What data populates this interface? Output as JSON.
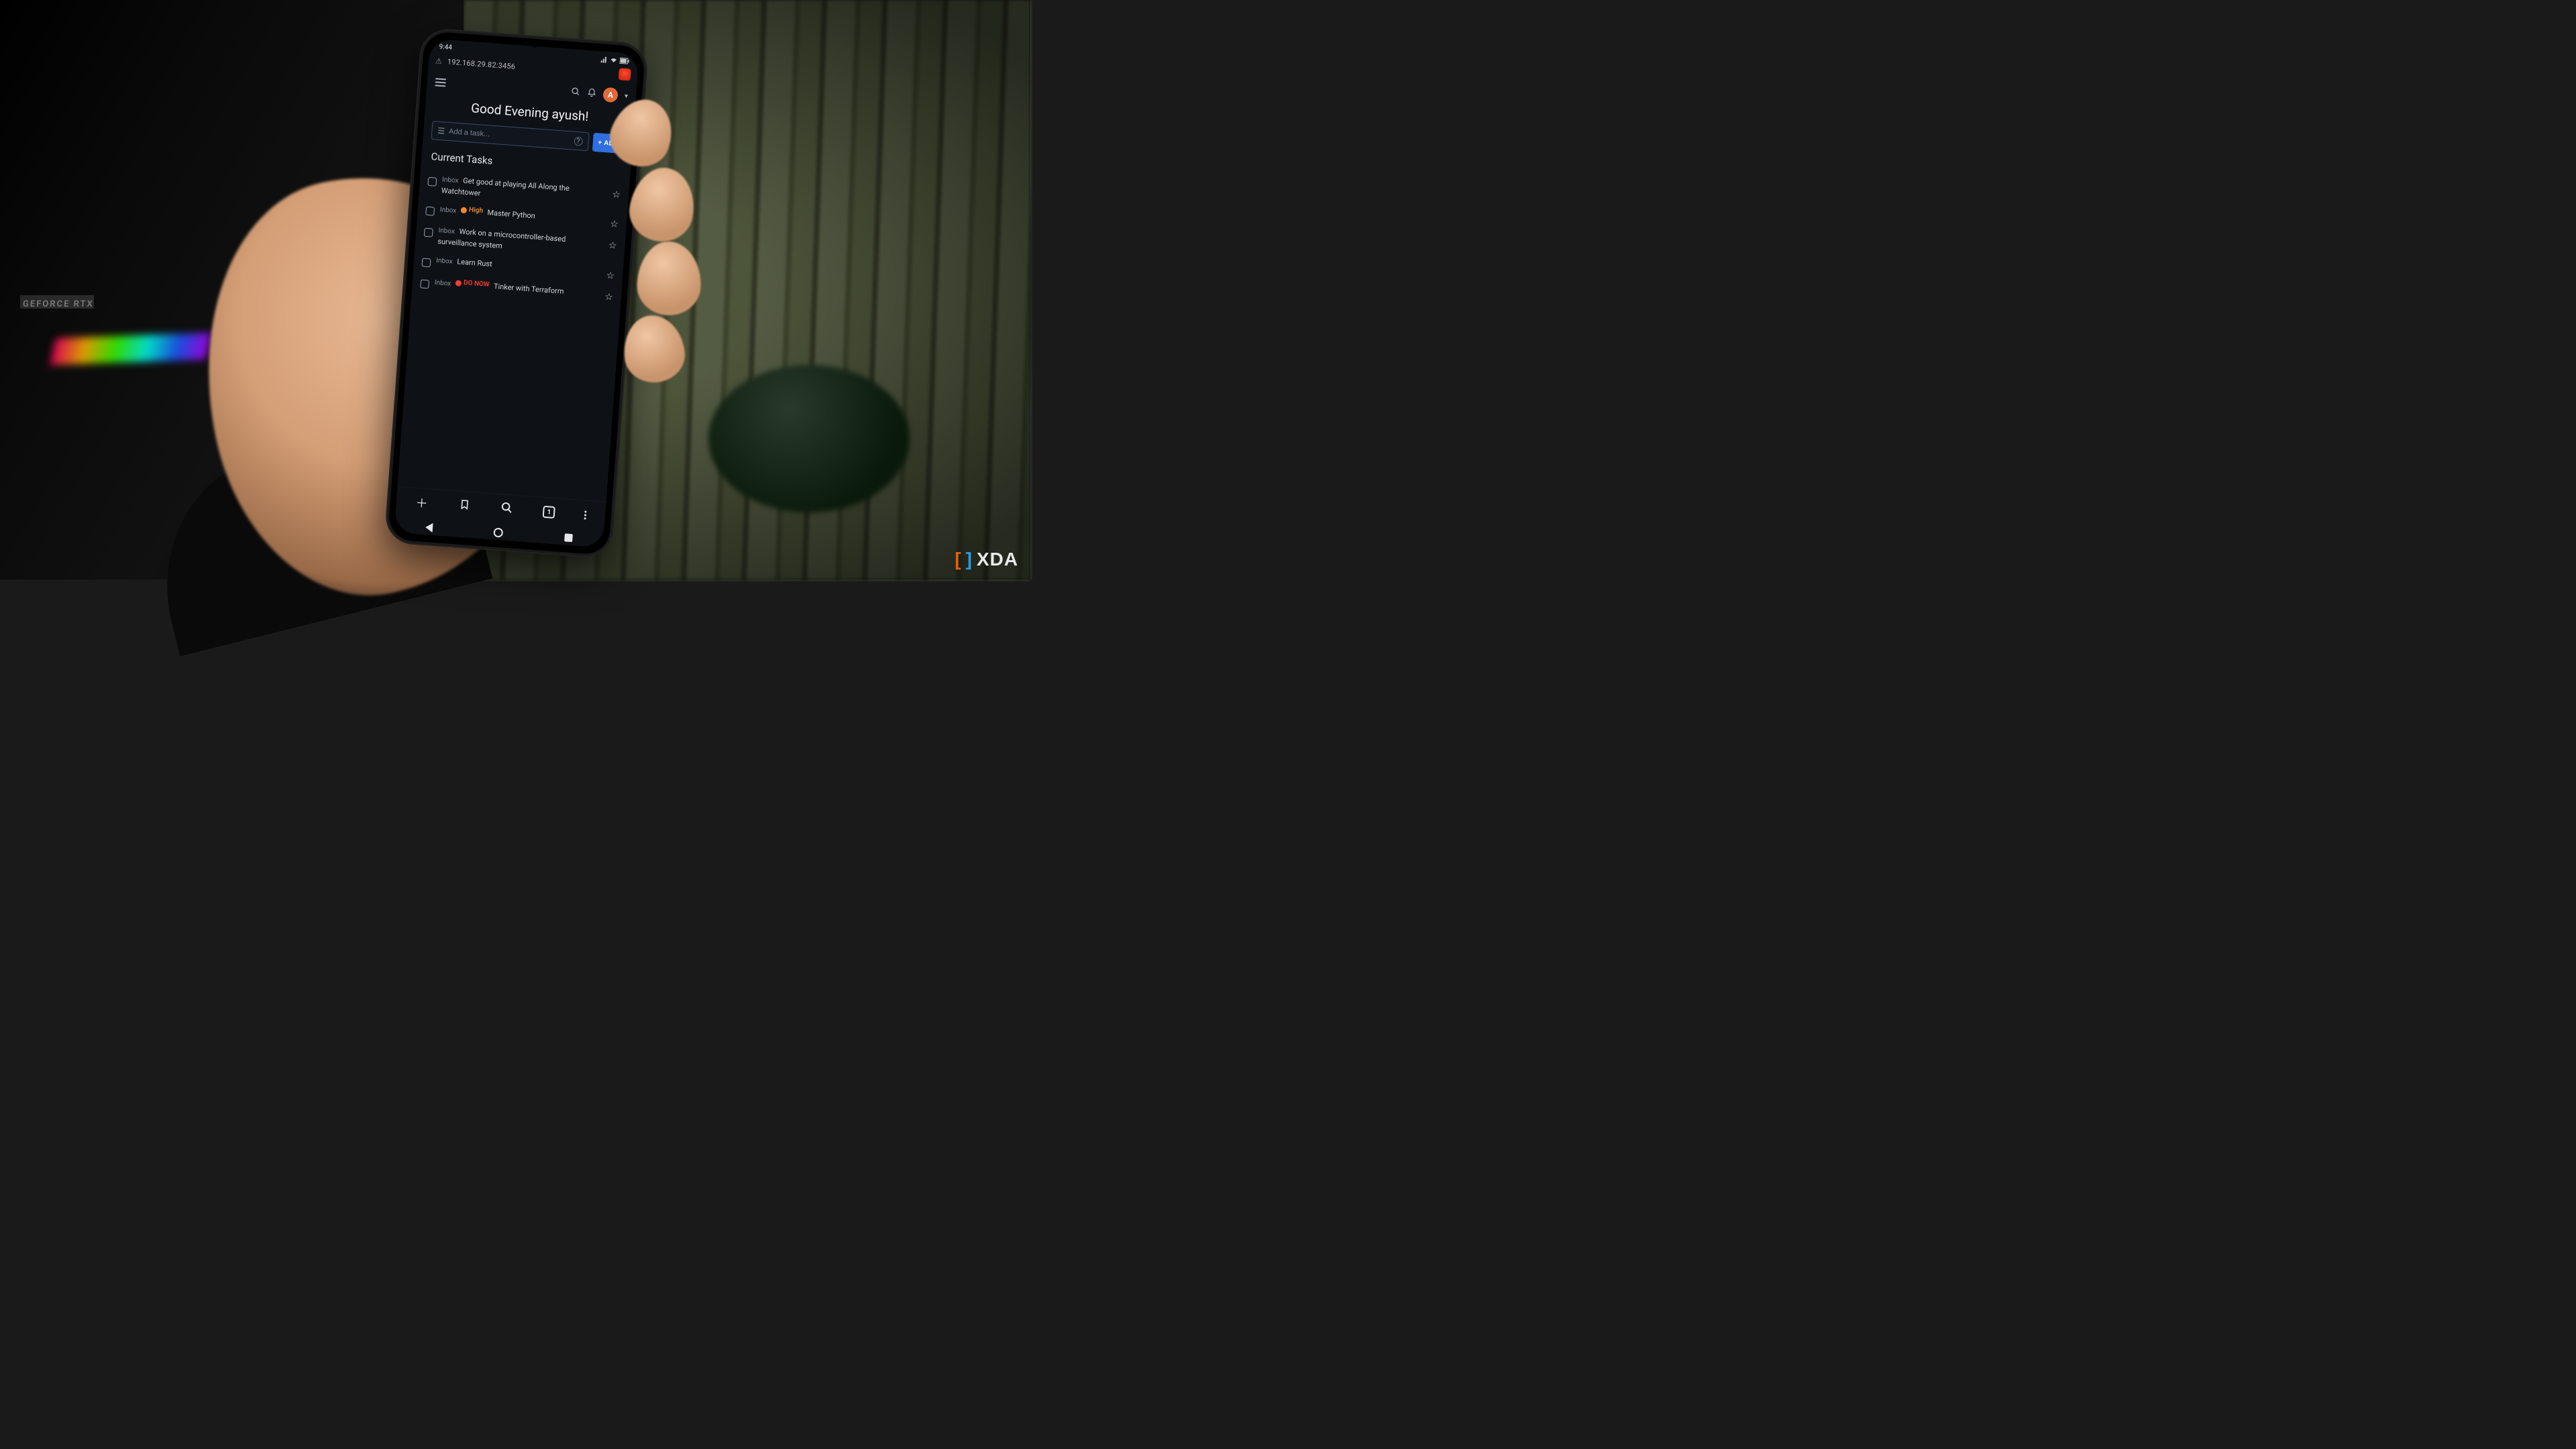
{
  "statusbar": {
    "time": "9:44"
  },
  "browser": {
    "url": "192.168.29.82:3456",
    "tab_count": "1"
  },
  "header": {
    "avatar_initial": "A"
  },
  "greeting": "Good Evening ayush!",
  "add_task": {
    "placeholder": "Add a task...",
    "button": "+ ADD"
  },
  "section_title": "Current Tasks",
  "tasks": [
    {
      "list": "Inbox",
      "priority": null,
      "title": "Get good at playing All Along the Watchtower"
    },
    {
      "list": "Inbox",
      "priority": "High",
      "title": "Master Python"
    },
    {
      "list": "Inbox",
      "priority": null,
      "title": "Work on a microcontroller-based surveillance system"
    },
    {
      "list": "Inbox",
      "priority": null,
      "title": "Learn Rust"
    },
    {
      "list": "Inbox",
      "priority": "DO NOW",
      "title": "Tinker with Terraform"
    }
  ],
  "background": {
    "gpu_label": "GEFORCE RTX"
  },
  "watermark": "XDA"
}
